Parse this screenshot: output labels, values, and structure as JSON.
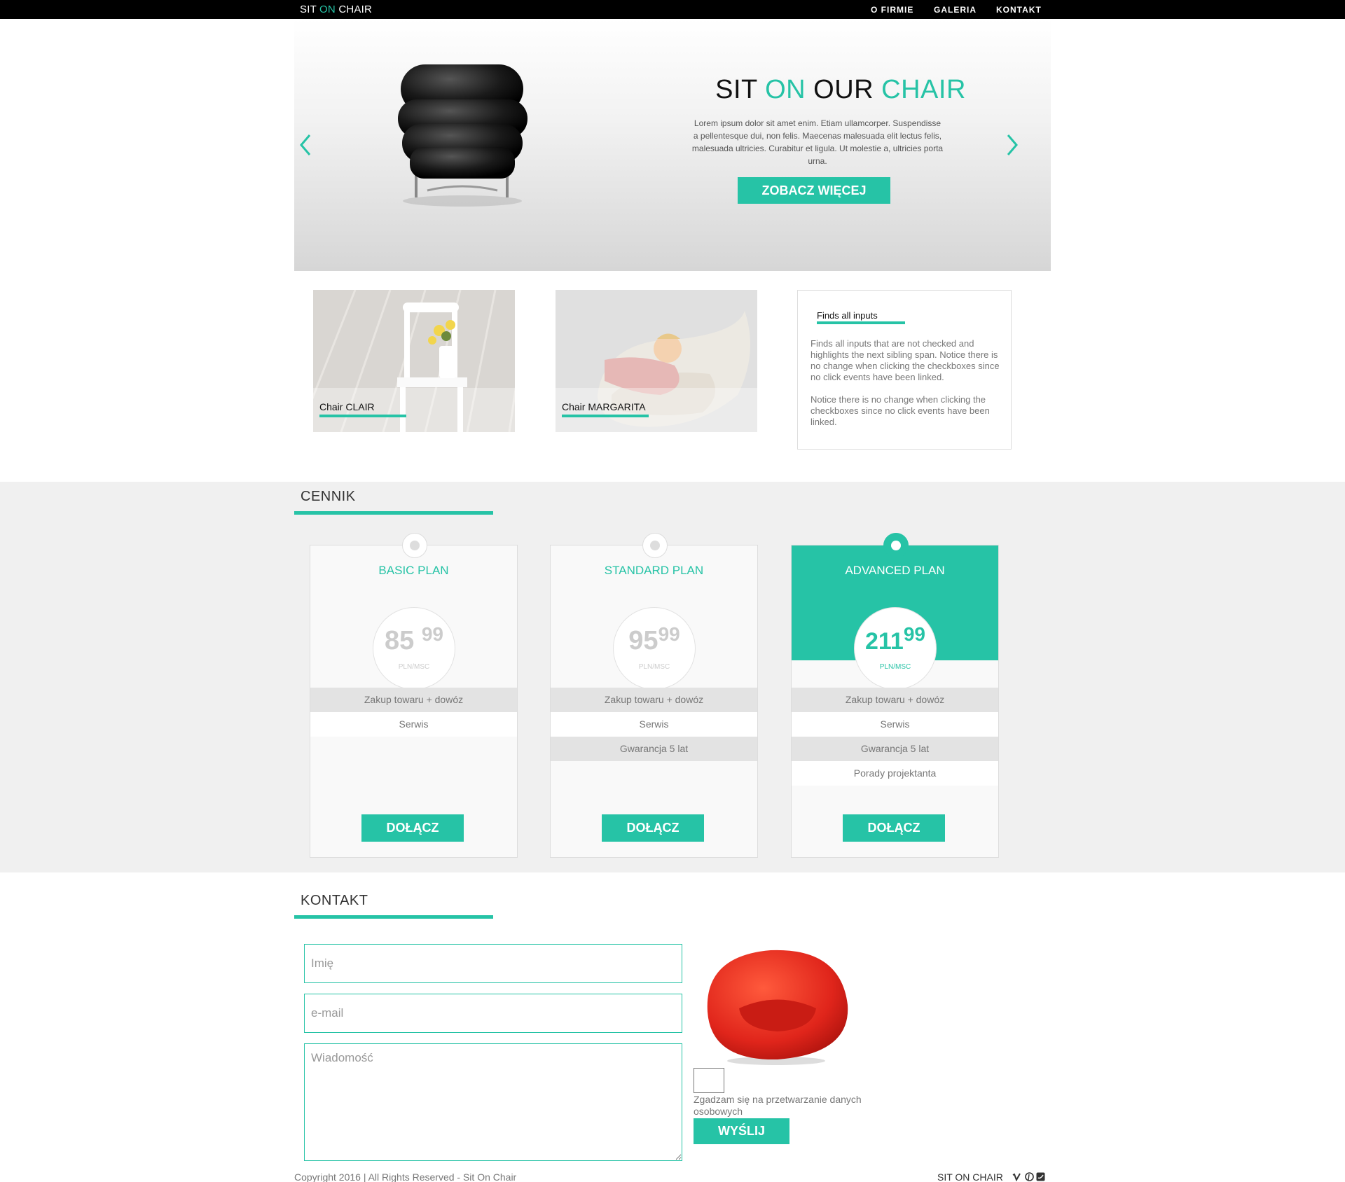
{
  "nav": {
    "logo_sit": "SIT",
    "logo_on": "ON",
    "logo_chair": "CHAIR",
    "items": [
      "O FIRMIE",
      "GALERIA",
      "KONTAKT"
    ]
  },
  "hero": {
    "title_sit": "SIT",
    "title_on": "ON",
    "title_our": "OUR",
    "title_chair": "CHAIR",
    "text": "Lorem ipsum dolor sit amet enim. Etiam ullamcorper. Suspendisse a pellentesque dui, non felis. Maecenas malesuada elit lectus felis, malesuada ultricies. Curabitur et ligula. Ut molestie a, ultricies porta urna.",
    "button": "ZOBACZ WIĘCEJ"
  },
  "products": [
    {
      "caption": "Chair CLAIR"
    },
    {
      "caption": "Chair MARGARITA"
    }
  ],
  "info": {
    "title": "Finds all inputs",
    "p1": "Finds all inputs that are not checked and highlights the next sibling span. Notice there is no change when clicking the checkboxes since no click events have been linked.",
    "p2": "Notice there is no change when clicking the checkboxes since no click events have been linked."
  },
  "pricing": {
    "title": "CENNIK",
    "plans": [
      {
        "name": "BASIC PLAN",
        "price": "85",
        "cents": "99",
        "unit": "PLN/MSC",
        "features": [
          "Zakup towaru + dowóz",
          "Serwis"
        ],
        "button": "DOŁĄCZ"
      },
      {
        "name": "STANDARD PLAN",
        "price": "95",
        "cents": "99",
        "unit": "PLN/MSC",
        "features": [
          "Zakup towaru + dowóz",
          "Serwis",
          "Gwarancja 5 lat"
        ],
        "button": "DOŁĄCZ"
      },
      {
        "name": "ADVANCED PLAN",
        "price": "211",
        "cents": "99",
        "unit": "PLN/MSC",
        "features": [
          "Zakup towaru + dowóz",
          "Serwis",
          "Gwarancja 5 lat",
          "Porady projektanta"
        ],
        "button": "DOŁĄCZ"
      }
    ]
  },
  "contact": {
    "title": "KONTAKT",
    "name_placeholder": "Imię",
    "email_placeholder": "e-mail",
    "message_placeholder": "Wiadomość",
    "consent": "Zgadzam się na przetwarzanie danych osobowych",
    "button": "WYŚLIJ"
  },
  "footer": {
    "copyright": "Copyright 2016 | All Rights Reserved - Sit On Chair",
    "brand": "SIT ON CHAIR"
  },
  "colors": {
    "accent": "#26c3a6",
    "topbar": "#000000",
    "pricing_bg": "#f0f0f0"
  },
  "icons": [
    "chevron-left-icon",
    "chevron-right-icon",
    "vimeo-icon",
    "pinterest-icon",
    "twitter-icon"
  ]
}
